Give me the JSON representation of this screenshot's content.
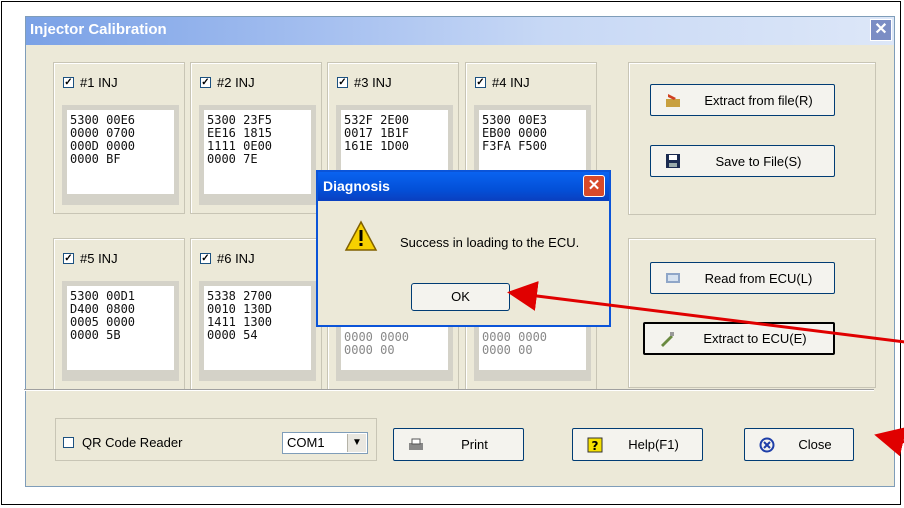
{
  "window": {
    "title": "Injector Calibration",
    "close_glyph": "✕"
  },
  "injectors": [
    {
      "label": "#1 INJ",
      "checked": true,
      "hex": "5300 00E6\n0000 0700\n000D 0000\n0000 BF"
    },
    {
      "label": "#2 INJ",
      "checked": true,
      "hex": "5300 23F5\nEE16 1815\n1111 0E00\n0000 7E"
    },
    {
      "label": "#3 INJ",
      "checked": true,
      "hex": "532F 2E00\n0017 1B1F\n161E 1D00"
    },
    {
      "label": "#4 INJ",
      "checked": true,
      "hex": "5300 00E3\nEB00 0000\nF3FA F500"
    },
    {
      "label": "#5 INJ",
      "checked": true,
      "hex": "5300 00D1\nD400 0800\n0005 0000\n0000 5B"
    },
    {
      "label": "#6 INJ",
      "checked": true,
      "hex": "5338 2700\n0010 130D\n1411 1300\n0000 54"
    },
    {
      "label": "",
      "checked": false,
      "hex": "0000 0000\n0000 00"
    },
    {
      "label": "",
      "checked": false,
      "hex": "0000 0000\n0000 00"
    }
  ],
  "file_buttons": {
    "extract_from_file": "Extract from file(R)",
    "save_to_file": "Save to File(S)"
  },
  "ecu_buttons": {
    "read_from_ecu": "Read from ECU(L)",
    "extract_to_ecu": "Extract to ECU(E)"
  },
  "bottom": {
    "qr_label": "QR Code Reader",
    "port": "COM1",
    "print": "Print",
    "help": "Help(F1)",
    "close": "Close"
  },
  "dialog": {
    "title": "Diagnosis",
    "message": "Success in loading to the ECU.",
    "ok": "OK",
    "close_glyph": "✕"
  },
  "icons": {
    "extract_file": "folder-extract-icon",
    "save": "floppy-disk-icon",
    "read_ecu": "ecu-read-icon",
    "extract_ecu": "ecu-write-icon",
    "print": "printer-icon",
    "help": "question-mark-icon",
    "close": "close-circle-icon",
    "warning": "warning-triangle-icon"
  },
  "colors": {
    "annotation_arrow": "#e00000",
    "title_blue": "#0350d8"
  }
}
